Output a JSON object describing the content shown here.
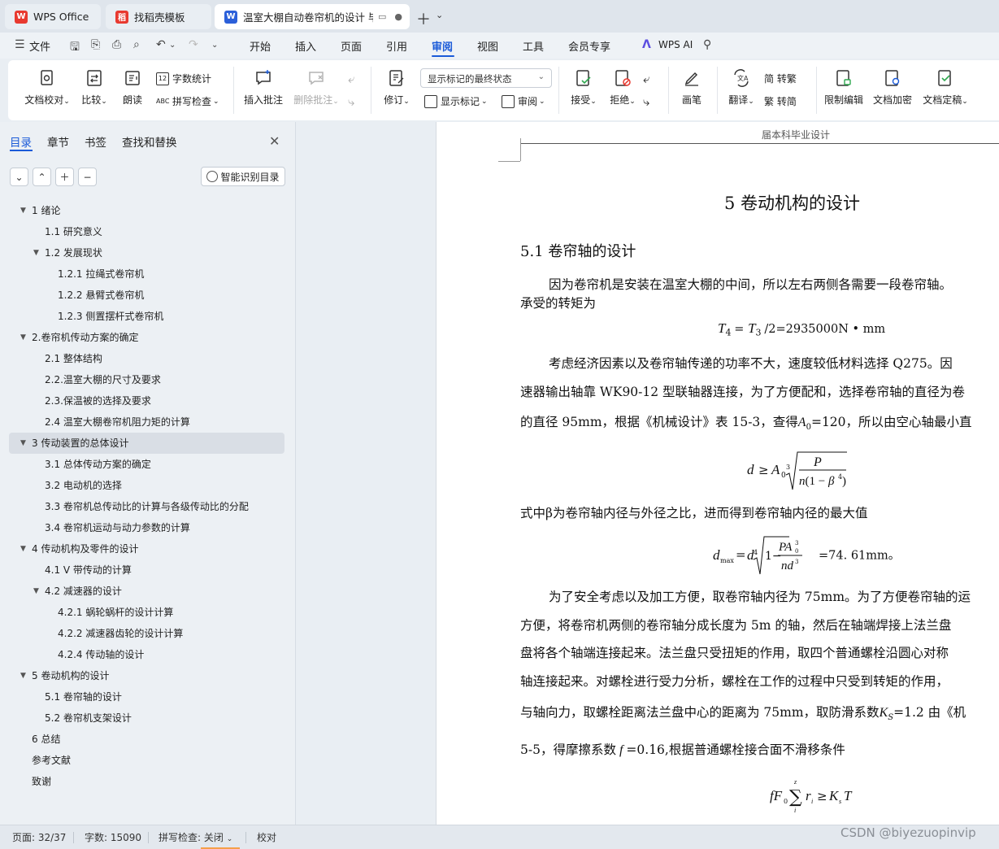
{
  "tabs": [
    {
      "label": "WPS Office",
      "icon": "wps-logo-icon"
    },
    {
      "label": "找稻壳模板",
      "icon": "docer-logo-icon"
    },
    {
      "label": "温室大棚自动卷帘机的设计 毕",
      "icon": "word-doc-icon",
      "active": true
    }
  ],
  "menubar": {
    "file_label": "文件",
    "items": [
      "开始",
      "插入",
      "页面",
      "引用",
      "审阅",
      "视图",
      "工具",
      "会员专享"
    ],
    "active": "审阅",
    "ai_label": "WPS AI"
  },
  "ribbon": {
    "doc_check": "文档校对",
    "compare": "比较",
    "read_aloud": "朗读",
    "word_count": "字数统计",
    "spell_check": "拼写检查",
    "insert_comment": "插入批注",
    "delete_comment": "删除批注",
    "track_changes": "修订",
    "markup_view": "显示标记的最终状态",
    "show_markup": "显示标记",
    "review": "审阅",
    "accept": "接受",
    "reject": "拒绝",
    "pen": "画笔",
    "translate": "翻译",
    "to_traditional": "简 转繁",
    "to_simplified": "繁 转简",
    "restrict_edit": "限制编辑",
    "encrypt": "文档加密",
    "finalize": "文档定稿"
  },
  "sidebar": {
    "tabs": [
      "目录",
      "章节",
      "书签",
      "查找和替换"
    ],
    "active_tab": "目录",
    "smart_button": "智能识别目录",
    "toc": [
      {
        "level": 1,
        "label": "1   绪论",
        "arrow": true
      },
      {
        "level": 2,
        "label": "1.1 研究意义"
      },
      {
        "level": 2,
        "label": "1.2 发展现状",
        "arrow": true
      },
      {
        "level": 3,
        "label": "1.2.1  拉绳式卷帘机"
      },
      {
        "level": 3,
        "label": "1.2.2  悬臂式卷帘机"
      },
      {
        "level": 3,
        "label": "1.2.3  侧置摆杆式卷帘机"
      },
      {
        "level": 1,
        "label": "2.卷帘机传动方案的确定",
        "arrow": true
      },
      {
        "level": 2,
        "label": "2.1 整体结构"
      },
      {
        "level": 2,
        "label": "2.2.温室大棚的尺寸及要求"
      },
      {
        "level": 2,
        "label": "2.3.保温被的选择及要求"
      },
      {
        "level": 2,
        "label": "2.4 温室大棚卷帘机阻力矩的计算"
      },
      {
        "level": 1,
        "label": "3 传动装置的总体设计",
        "arrow": true,
        "selected": true
      },
      {
        "level": 2,
        "label": "3.1 总体传动方案的确定"
      },
      {
        "level": 2,
        "label": "3.2 电动机的选择"
      },
      {
        "level": 2,
        "label": "3.3  卷帘机总传动比的计算与各级传动比的分配"
      },
      {
        "level": 2,
        "label": "3.4  卷帘机运动与动力参数的计算"
      },
      {
        "level": 1,
        "label": "4 传动机构及零件的设计",
        "arrow": true
      },
      {
        "level": 2,
        "label": "4.1 V 带传动的计算"
      },
      {
        "level": 2,
        "label": "4.2 减速器的设计",
        "arrow": true
      },
      {
        "level": 3,
        "label": "4.2.1  蜗轮蜗杆的设计计算"
      },
      {
        "level": 3,
        "label": "4.2.2 减速器齿轮的设计计算"
      },
      {
        "level": 3,
        "label": "4.2.4  传动轴的设计"
      },
      {
        "level": 1,
        "label": "5 卷动机构的设计",
        "arrow": true
      },
      {
        "level": 2,
        "label": "5.1 卷帘轴的设计"
      },
      {
        "level": 2,
        "label": "5.2 卷帘机支架设计"
      },
      {
        "level": 1,
        "label": "6 总结"
      },
      {
        "level": 1,
        "label": "参考文献"
      },
      {
        "level": 1,
        "label": "致谢"
      }
    ]
  },
  "document": {
    "header": "届本科毕业设计",
    "chapter_title": "5 卷动机构的设计",
    "section_title": "5.1 卷帘轴的设计",
    "p1_line1": "因为卷帘机是安装在温室大棚的中间，所以左右两侧各需要一段卷帘轴。",
    "p1_line2": "承受的转矩为",
    "eq1_value": "/2=2935000N • mm",
    "p2_line1": "考虑经济因素以及卷帘轴传递的功率不大，速度较低材料选择  Q275。因",
    "p2_line2": "速器输出轴靠 WK90-12 型联轴器连接，为了方便配和，选择卷帘轴的直径为卷",
    "p2_line3a": "的直径 95mm，根据《机械设计》表 15-3，查得",
    "p2_line3b": "=120，所以由空心轴最小直",
    "p3": "式中β为卷帘轴内径与外径之比，进而得到卷帘轴内径的最大值",
    "eq3_value": "=74. 61mm。",
    "p4_line1": "为了安全考虑以及加工方便，取卷帘轴内径为 75mm。为了方便卷帘轴的运",
    "p4_line2": "方便，将卷帘机两侧的卷帘轴分成长度为 5m 的轴，然后在轴端焊接上法兰盘",
    "p4_line3": "盘将各个轴端连接起来。法兰盘只受扭矩的作用，取四个普通螺栓沿圆心对称",
    "p4_line4": "轴连接起来。对螺栓进行受力分析，螺栓在工作的过程中只受到转矩的作用，",
    "p4_line5a": "与轴向力，取螺栓距离法兰盘中心的距离为 75mm，取防滑系数",
    "p4_line5b": "=1.2 由《机",
    "p4_line6a": "5-5，得摩擦系数",
    "p4_line6b": "=0.16,根据普通螺栓接合面不滑移条件"
  },
  "statusbar": {
    "page": "页面: 32/37",
    "word_count": "字数: 15090",
    "spell_check": "拼写检查: 关闭",
    "proofread": "校对"
  },
  "watermark": "CSDN @biyezuopinvip",
  "colors": {
    "accent": "#1a5ad8",
    "wps_red": "#e8392f",
    "word_blue": "#2b5fd9"
  }
}
